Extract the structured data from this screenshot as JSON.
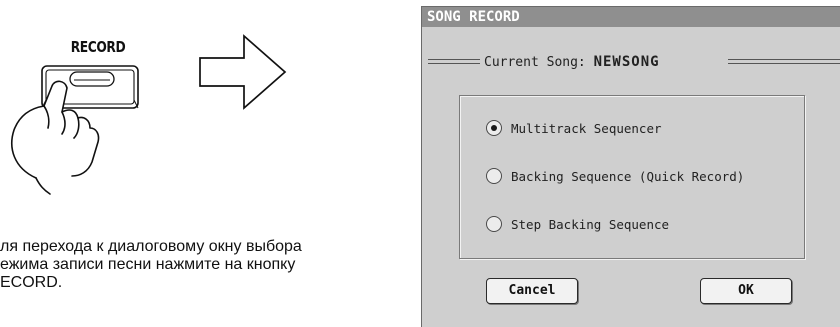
{
  "illustration": {
    "button_caption": "RECORD",
    "instruction": "ля перехода к диалоговому окну выбора\nежима записи песни нажмите на кнопку\nECORD."
  },
  "dialog": {
    "title": "SONG RECORD",
    "current_song_label": "Current Song:",
    "current_song_name": "NEWSONG",
    "options": [
      {
        "label": "Multitrack Sequencer",
        "selected": true
      },
      {
        "label": "Backing Sequence (Quick Record)",
        "selected": false
      },
      {
        "label": "Step Backing Sequence",
        "selected": false
      }
    ],
    "buttons": {
      "cancel": "Cancel",
      "ok": "OK"
    }
  },
  "colors": {
    "dialog_bg": "#cfcfcf",
    "titlebar_bg": "#8f8f8f",
    "titlebar_text": "#ffffff"
  }
}
